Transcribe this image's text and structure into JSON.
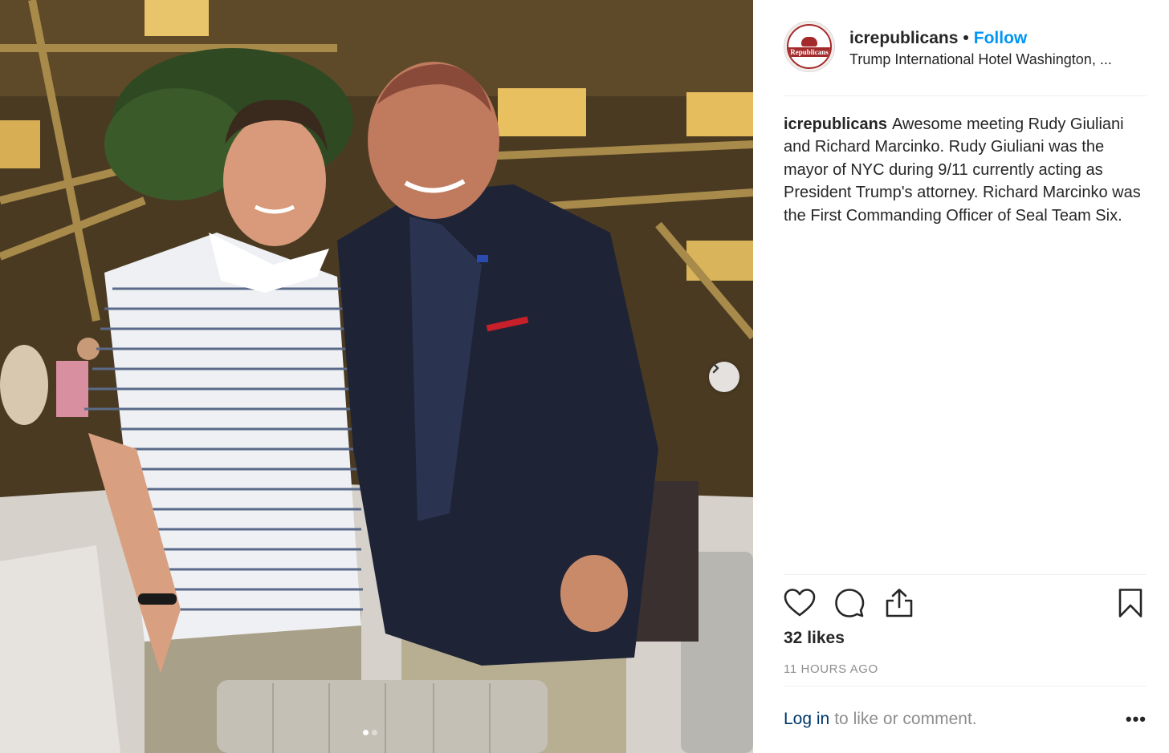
{
  "post": {
    "username": "icrepublicans",
    "separator": "•",
    "follow_label": "Follow",
    "location": "Trump International Hotel Washington, ...",
    "avatar_text": "Republicans",
    "caption_user": "icrepublicans",
    "caption_text": "Awesome meeting Rudy Giuliani and Richard Marcinko. Rudy Giuliani was the mayor of NYC during 9/11 currently acting as President Trump's attorney. Richard Marcinko was the First Commanding Officer of Seal Team Six.",
    "likes": "32 likes",
    "time_ago": "11 HOURS AGO",
    "login_link": "Log in",
    "login_suffix": "to like or comment.",
    "more_label": "•••"
  },
  "carousel": {
    "current": 1,
    "total": 2
  },
  "icons": {
    "like": "heart-icon",
    "comment": "comment-icon",
    "share": "share-icon",
    "save": "bookmark-icon",
    "next": "chevron-right-icon"
  },
  "colors": {
    "link_blue": "#0095f6",
    "login_blue": "#00376b",
    "muted": "#8e8e8e",
    "text": "#262626"
  }
}
